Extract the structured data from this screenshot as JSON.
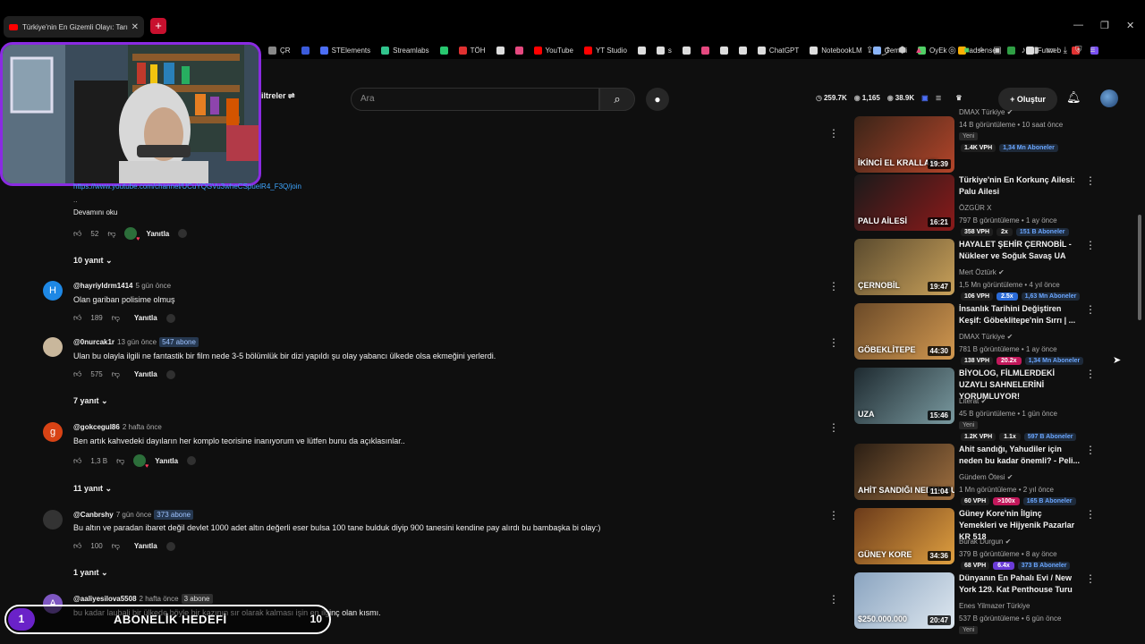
{
  "browser": {
    "tab_title": "Türkiye'nin En Gizemli Olayı: Tarı",
    "new_tab": "+",
    "bookmarks": [
      {
        "label": "ÇR",
        "color": "#888"
      },
      {
        "label": "",
        "color": "#3b5bdb"
      },
      {
        "label": "STElements",
        "color": "#4c6ef5"
      },
      {
        "label": "Streamlabs",
        "color": "#31c48d"
      },
      {
        "label": "",
        "color": "#28c76f"
      },
      {
        "label": "TÖH",
        "color": "#e03131"
      },
      {
        "label": "",
        "color": "#ddd"
      },
      {
        "label": "",
        "color": "#e64980"
      },
      {
        "label": "YouTube",
        "color": "#ff0000"
      },
      {
        "label": "YT Studio",
        "color": "#ff0000"
      },
      {
        "label": "",
        "color": "#ddd"
      },
      {
        "label": "s",
        "color": "#ddd"
      },
      {
        "label": "",
        "color": "#ddd"
      },
      {
        "label": "",
        "color": "#e64980"
      },
      {
        "label": "",
        "color": "#ddd"
      },
      {
        "label": "",
        "color": "#ddd"
      },
      {
        "label": "ChatGPT",
        "color": "#ddd"
      },
      {
        "label": "NotebookLM",
        "color": "#ddd"
      },
      {
        "label": "Gemini",
        "color": "#8ab4f8"
      },
      {
        "label": "OyEk",
        "color": "#51cf66"
      },
      {
        "label": "adsense",
        "color": "#fab005"
      },
      {
        "label": "",
        "color": "#2f9e44"
      },
      {
        "label": "Futweb",
        "color": "#ddd"
      },
      {
        "label": "",
        "color": "#e03131"
      },
      {
        "label": "",
        "color": "#7950f2"
      }
    ]
  },
  "header": {
    "filters_label": "iltreler",
    "search_placeholder": "Ara",
    "stats": [
      "259.7K",
      "1,165",
      "38.9K"
    ],
    "create_label": "Oluştur"
  },
  "comments": [
    {
      "link": "https://www.youtube.com/channel/UCuYQGVu3wheCSpuelR4_F3Q/join",
      "ellipsis": "..",
      "read_more": "Devamını oku",
      "likes": "52",
      "reply_label": "Yanıtla",
      "replies": "10 yanıt"
    },
    {
      "avatar_letter": "H",
      "avatar_color": "#1e88e5",
      "user": "@hayriyldrm1414",
      "time": "5 gün önce",
      "badge": "",
      "text": "Olan gariban polisime olmuş",
      "likes": "189",
      "reply_label": "Yanıtla",
      "replies": ""
    },
    {
      "avatar_letter": "",
      "avatar_color": "#c9b79c",
      "user": "@0nurcak1r",
      "time": "13 gün önce",
      "badge": "547 abone",
      "text": "Ulan bu olayla ilgili ne fantastik bir film nede 3-5 bölümlük bir dizi yapıldı şu olay yabancı ülkede olsa ekmeğini yerlerdi.",
      "likes": "575",
      "reply_label": "Yanıtla",
      "replies": "7 yanıt"
    },
    {
      "avatar_letter": "g",
      "avatar_color": "#d84315",
      "user": "@gokcegul86",
      "time": "2 hafta önce",
      "badge": "",
      "text": "Ben artık kahvedeki dayıların her komplo teorisine inanıyorum ve lütfen bunu da açıklasınlar..",
      "likes": "1,3 B",
      "reply_label": "Yanıtla",
      "replies": "11 yanıt"
    },
    {
      "avatar_letter": "",
      "avatar_color": "#333",
      "user": "@Canbrshy",
      "time": "7 gün önce",
      "badge": "373 abone",
      "text": "Bu altın ve paradan ibaret değil devlet 1000 adet altın değerli eser bulsa 100 tane bulduk diyip 900 tanesini kendine pay alırdı bu bambaşka bi olay:)",
      "likes": "100",
      "reply_label": "Yanıtla",
      "replies": "1 yanıt"
    },
    {
      "avatar_letter": "A",
      "avatar_color": "#7e57c2",
      "user": "@aaliyesilova5508",
      "time": "2 hafta önce",
      "badge": "3 abone",
      "text": "bu kadar laubali bir ülkede böyle bir kazının sır olarak kalması işin en ilginç olan kısmı.",
      "likes": "",
      "reply_label": "",
      "replies": ""
    }
  ],
  "sidebar": [
    {
      "title": "",
      "thumb_text": "İKİNCİ EL KRALLARI",
      "duration": "19:39",
      "channel": "DMAX Türkiye",
      "verified": true,
      "meta": "14 B görüntüleme • 10 saat önce",
      "is_new": "Yeni",
      "vph": "1.4K VPH",
      "mult": "",
      "mult_style": "",
      "subs": "1,34 Mn Aboneler",
      "colors": [
        "#3a2418",
        "#b3452a"
      ]
    },
    {
      "title": "Türkiye'nin En Korkunç Ailesi: Palu Ailesi",
      "thumb_text": "PALU AİLESİ",
      "duration": "16:21",
      "channel": "ÖZGÜR X",
      "verified": false,
      "meta": "797 B görüntüleme • 1 ay önce",
      "is_new": "",
      "vph": "358 VPH",
      "mult": "2x",
      "mult_style": "",
      "subs": "151 B Aboneler",
      "colors": [
        "#1a1a1a",
        "#8b1a1a"
      ]
    },
    {
      "title": "HAYALET ŞEHİR ÇERNOBİL - Nükleer ve Soğuk Savaş UA",
      "thumb_text": "ÇERNOBİL",
      "duration": "19:47",
      "channel": "Mert Öztürk",
      "verified": true,
      "meta": "1,5 Mn görüntüleme • 4 yıl önce",
      "is_new": "",
      "vph": "106 VPH",
      "mult": "2.5x",
      "mult_style": "blue",
      "subs": "1,63 Mn Aboneler",
      "colors": [
        "#5a4a2e",
        "#c9a15a"
      ]
    },
    {
      "title": "İnsanlık Tarihini Değiştiren Keşif: Göbeklitepe'nin Sırrı | ...",
      "thumb_text": "GÖBEKLİTEPE",
      "duration": "44:30",
      "channel": "DMAX Türkiye",
      "verified": true,
      "meta": "781 B görüntüleme • 1 ay önce",
      "is_new": "",
      "vph": "138 VPH",
      "mult": "20.2x",
      "mult_style": "red",
      "subs": "1,34 Mn Aboneler",
      "colors": [
        "#6b4a28",
        "#d19850"
      ]
    },
    {
      "title": "BİYOLOG, FİLMLERDEKİ UZAYLI SAHNELERİNİ YORUMLUYOR!",
      "thumb_text": "UZA",
      "duration": "15:46",
      "channel": "Literat",
      "verified": true,
      "meta": "45 B görüntüleme • 1 gün önce",
      "is_new": "Yeni",
      "vph": "1.2K VPH",
      "mult": "1.1x",
      "mult_style": "",
      "subs": "597 B Aboneler",
      "colors": [
        "#1e2a30",
        "#7a9aa0"
      ]
    },
    {
      "title": "Ahit sandığı, Yahudiler için neden bu kadar önemli? - Peli...",
      "thumb_text": "AHİT SANDIĞI NEDEN BU KADAR ÖNE",
      "duration": "11:04",
      "channel": "Gündem Ötesi",
      "verified": true,
      "meta": "1 Mn görüntüleme • 2 yıl önce",
      "is_new": "",
      "vph": "60 VPH",
      "mult": ">100x",
      "mult_style": "red",
      "subs": "165 B Aboneler",
      "colors": [
        "#2a1e14",
        "#a07040"
      ]
    },
    {
      "title": "Güney Kore'nin İlginç Yemekleri ve Hijyenik Pazarlar KR 518",
      "thumb_text": "GÜNEY KORE",
      "duration": "34:36",
      "channel": "Burak Durgun",
      "verified": true,
      "meta": "379 B görüntüleme • 8 ay önce",
      "is_new": "",
      "vph": "68 VPH",
      "mult": "6.4x",
      "mult_style": "purple",
      "subs": "373 B Aboneler",
      "colors": [
        "#6a3a1a",
        "#e0a040"
      ]
    },
    {
      "title": "Dünyanın En Pahalı Evi / New York 129. Kat Penthouse Turu",
      "thumb_text": "$250.000.000",
      "duration": "20:47",
      "channel": "Enes Yilmazer Türkiye",
      "verified": false,
      "meta": "537 B görüntüleme • 6 gün önce",
      "is_new": "Yeni",
      "vph": "",
      "mult": "",
      "mult_style": "",
      "subs": "",
      "colors": [
        "#8aa4c0",
        "#dfe8f0"
      ]
    }
  ],
  "goal": {
    "current": "1",
    "label": "ABONELİK HEDEFİ",
    "target": "10"
  }
}
